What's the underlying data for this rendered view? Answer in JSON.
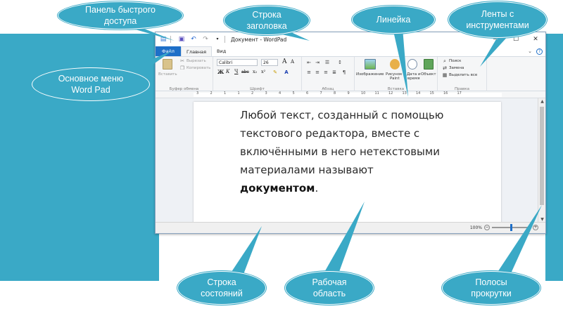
{
  "window": {
    "title": "Документ - WordPad",
    "controls": {
      "minimize": "—",
      "maximize": "☐",
      "close": "✕"
    }
  },
  "tabs": {
    "file": "Файл",
    "home": "Главная",
    "view": "Вид",
    "help_icon": "?"
  },
  "ribbon": {
    "clipboard": {
      "paste": "Вставить",
      "cut": "Вырезать",
      "copy": "Копировать",
      "label": "Буфер обмена"
    },
    "font": {
      "family": "Calibri",
      "size": "26",
      "bold": "Ж",
      "italic": "К",
      "underline": "Ч",
      "strike": "abc",
      "sub": "x₂",
      "sup": "x²",
      "grow": "A",
      "shrink": "A",
      "label": "Шрифт"
    },
    "paragraph": {
      "label": "Абзац"
    },
    "insert": {
      "image": "Изображение",
      "drawing_a": "Рисунок",
      "drawing_b": "Paint",
      "datetime_a": "Дата и",
      "datetime_b": "время",
      "object": "Объект",
      "label": "Вставка"
    },
    "editing": {
      "find": "Поиск",
      "replace": "Замена",
      "select_all": "Выделить все",
      "label": "Правка"
    }
  },
  "ruler": {
    "numbers": [
      "3",
      "2",
      "1",
      "1",
      "2",
      "3",
      "4",
      "5",
      "6",
      "7",
      "8",
      "9",
      "10",
      "11",
      "12",
      "13",
      "14",
      "15",
      "16",
      "17"
    ]
  },
  "document": {
    "line1": "Любой текст, созданный с помощью",
    "line2": "текстового редактора, вместе с",
    "line3": "включёнными в него нетекстовыми",
    "line4": "материалами называют",
    "line5_bold": "документом",
    "line5_end": "."
  },
  "status": {
    "zoom": "100%",
    "zoom_out": "−",
    "zoom_in": "+"
  },
  "callouts": {
    "quick_access": "Панель быстрого доступа",
    "title_bar": "Строка заголовка",
    "ruler": "Линейка",
    "ribbons": "Ленты с инструментами",
    "main_menu": "Основное меню Word Pad",
    "status_bar": "Строка состояний",
    "work_area": "Рабочая область",
    "scrollbars": "Полосы прокрутки"
  },
  "colors": {
    "teal": "#3aa9c6",
    "file_tab": "#1e6fc8"
  }
}
